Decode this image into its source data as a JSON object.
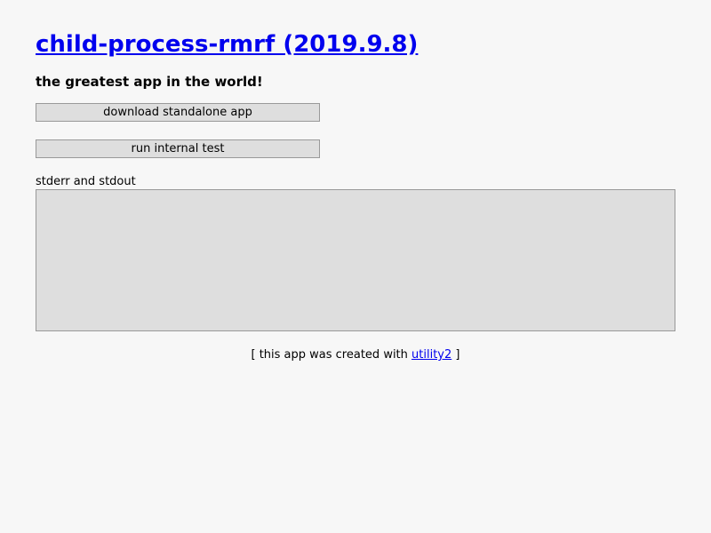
{
  "header": {
    "title": "child-process-rmrf (2019.9.8)",
    "subtitle": "the greatest app in the world!"
  },
  "actions": {
    "download_label": "download standalone app",
    "test_label": "run internal test"
  },
  "output": {
    "label": "stderr and stdout",
    "value": ""
  },
  "footer": {
    "prefix": "[ this app was created with ",
    "link_text": "utility2",
    "suffix": " ]"
  },
  "colors": {
    "link": "#0000ee",
    "background": "#f7f7f7",
    "control_bg": "#dedede"
  }
}
